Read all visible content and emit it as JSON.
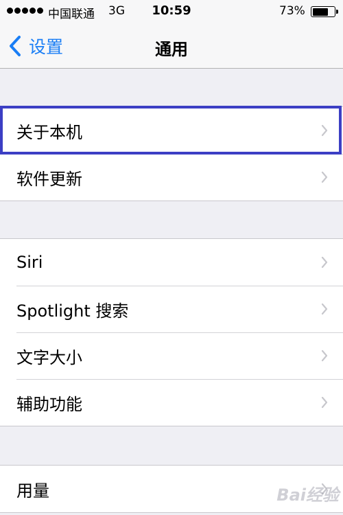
{
  "status_bar": {
    "carrier": "中国联通",
    "network": "3G",
    "time": "10:59",
    "battery_percent": "73%",
    "battery_level": 0.73,
    "signal_dots": 5
  },
  "nav": {
    "back_label": "设置",
    "title": "通用"
  },
  "groups": [
    {
      "items": [
        {
          "label": "关于本机"
        },
        {
          "label": "软件更新"
        }
      ]
    },
    {
      "items": [
        {
          "label": "Siri"
        },
        {
          "label": "Spotlight 搜索"
        },
        {
          "label": "文字大小"
        },
        {
          "label": "辅助功能"
        }
      ]
    },
    {
      "items": [
        {
          "label": "用量"
        }
      ]
    }
  ],
  "colors": {
    "accent": "#1a7ef5",
    "highlight": "#3c3fc4",
    "background": "#efeff4"
  },
  "icons": {
    "back": "chevron-left-icon",
    "row": "chevron-right-icon"
  },
  "watermark": "Bai经验"
}
